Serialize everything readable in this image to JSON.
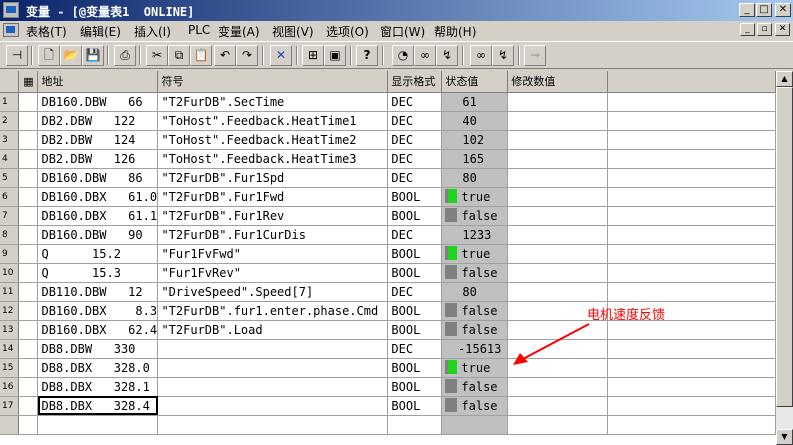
{
  "window": {
    "title": "变量 - [@变量表1  ONLINE]"
  },
  "menu": [
    "表格(T)",
    "编辑(E)",
    "插入(I)",
    "PLC",
    "变量(A)",
    "视图(V)",
    "选项(O)",
    "窗口(W)",
    "帮助(H)"
  ],
  "grid": {
    "headers": {
      "address": "地址",
      "symbol": "符号",
      "display_format": "显示格式",
      "status_value": "状态值",
      "modify_value": "修改数值"
    },
    "rows": [
      {
        "n": "1",
        "addr": "DB160.DBW   66",
        "sym": "\"T2FurDB\".SecTime",
        "fmt": "DEC",
        "val": "61",
        "ind": ""
      },
      {
        "n": "2",
        "addr": "DB2.DBW   122",
        "sym": "\"ToHost\".Feedback.HeatTime1",
        "fmt": "DEC",
        "val": "40",
        "ind": ""
      },
      {
        "n": "3",
        "addr": "DB2.DBW   124",
        "sym": "\"ToHost\".Feedback.HeatTime2",
        "fmt": "DEC",
        "val": "102",
        "ind": ""
      },
      {
        "n": "4",
        "addr": "DB2.DBW   126",
        "sym": "\"ToHost\".Feedback.HeatTime3",
        "fmt": "DEC",
        "val": "165",
        "ind": ""
      },
      {
        "n": "5",
        "addr": "DB160.DBW   86",
        "sym": "\"T2FurDB\".Fur1Spd",
        "fmt": "DEC",
        "val": "80",
        "ind": ""
      },
      {
        "n": "6",
        "addr": "DB160.DBX   61.0",
        "sym": "\"T2FurDB\".Fur1Fwd",
        "fmt": "BOOL",
        "val": "true",
        "ind": "on"
      },
      {
        "n": "7",
        "addr": "DB160.DBX   61.1",
        "sym": "\"T2FurDB\".Fur1Rev",
        "fmt": "BOOL",
        "val": "false",
        "ind": "off"
      },
      {
        "n": "8",
        "addr": "DB160.DBW   90",
        "sym": "\"T2FurDB\".Fur1CurDis",
        "fmt": "DEC",
        "val": "1233",
        "ind": ""
      },
      {
        "n": "9",
        "addr": "Q      15.2",
        "sym": "\"Fur1FvFwd\"",
        "fmt": "BOOL",
        "val": "true",
        "ind": "on"
      },
      {
        "n": "10",
        "addr": "Q      15.3",
        "sym": "\"Fur1FvRev\"",
        "fmt": "BOOL",
        "val": "false",
        "ind": "off"
      },
      {
        "n": "11",
        "addr": "DB110.DBW   12",
        "sym": "\"DriveSpeed\".Speed[7]",
        "fmt": "DEC",
        "val": "80",
        "ind": ""
      },
      {
        "n": "12",
        "addr": "DB160.DBX    8.3",
        "sym": "\"T2FurDB\".fur1.enter.phase.Cmd",
        "fmt": "BOOL",
        "val": "false",
        "ind": "off"
      },
      {
        "n": "13",
        "addr": "DB160.DBX   62.4",
        "sym": "\"T2FurDB\".Load",
        "fmt": "BOOL",
        "val": "false",
        "ind": "off"
      },
      {
        "n": "14",
        "addr": "DB8.DBW   330",
        "sym": "",
        "fmt": "DEC",
        "val": "-15613",
        "ind": ""
      },
      {
        "n": "15",
        "addr": "DB8.DBX   328.0",
        "sym": "",
        "fmt": "BOOL",
        "val": "true",
        "ind": "on"
      },
      {
        "n": "16",
        "addr": "DB8.DBX   328.1",
        "sym": "",
        "fmt": "BOOL",
        "val": "false",
        "ind": "off"
      },
      {
        "n": "17",
        "addr": "DB8.DBX   328.4",
        "sym": "",
        "fmt": "BOOL",
        "val": "false",
        "ind": "off"
      }
    ]
  },
  "annotation": {
    "text": "电机速度反馈",
    "color": "#ff0000"
  },
  "colors": {
    "indicator_on": "#1fd41f",
    "indicator_off": "#808080",
    "status_column": "#c0c0c0",
    "title_bar": "#0a246a"
  }
}
